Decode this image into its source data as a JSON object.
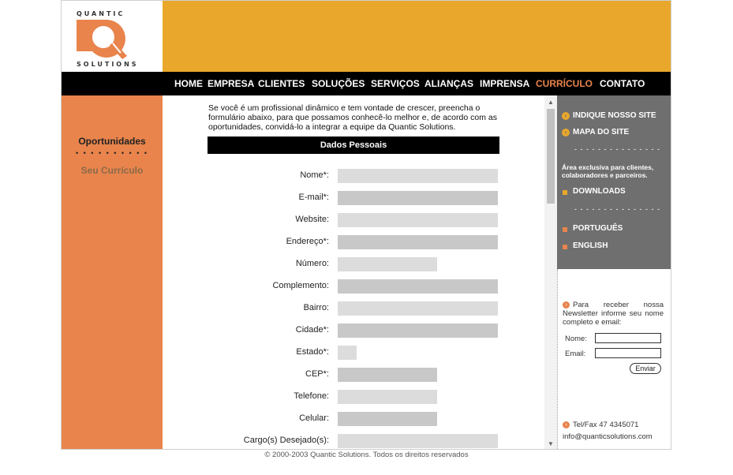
{
  "logo": {
    "top_text": "QUANTIC",
    "bottom_text": "SOLUTIONS"
  },
  "nav": [
    {
      "label": "HOME",
      "active": false
    },
    {
      "label": "EMPRESA",
      "active": false
    },
    {
      "label": "CLIENTES",
      "active": false
    },
    {
      "label": "SOLUÇÕES",
      "active": false
    },
    {
      "label": "SERVIÇOS",
      "active": false
    },
    {
      "label": "ALIANÇAS",
      "active": false
    },
    {
      "label": "IMPRENSA",
      "active": false
    },
    {
      "label": "CURRÍCULO",
      "active": true
    },
    {
      "label": "CONTATO",
      "active": false
    }
  ],
  "sidebar": {
    "opportunities": "Oportunidades",
    "dots": "• • • • • • • • • •",
    "curriculum": "Seu Currículo"
  },
  "main": {
    "intro": "Se você é um profissional dinâmico e tem vontade de crescer, preencha o formulário abaixo, para que possamos conhecê-lo melhor e, de acordo com as oportunidades, convidá-lo a integrar a equipe da Quantic Solutions.",
    "section_title": "Dados Pessoais",
    "fields": [
      {
        "label": "Nome*:",
        "value": ""
      },
      {
        "label": "E-mail*:",
        "value": ""
      },
      {
        "label": "Website:",
        "value": ""
      },
      {
        "label": "Endereço*:",
        "value": ""
      },
      {
        "label": "Número:",
        "value": ""
      },
      {
        "label": "Complemento:",
        "value": ""
      },
      {
        "label": "Bairro:",
        "value": ""
      },
      {
        "label": "Cidade*:",
        "value": ""
      },
      {
        "label": "Estado*:",
        "value": ""
      },
      {
        "label": "CEP*:",
        "value": ""
      },
      {
        "label": "Telefone:",
        "value": ""
      },
      {
        "label": "Celular:",
        "value": ""
      },
      {
        "label": "Cargo(s) Desejado(s):",
        "value": ""
      }
    ]
  },
  "right": {
    "links": [
      {
        "label": "INDIQUE NOSSO SITE",
        "icon": "arrow-circle-icon"
      },
      {
        "label": "MAPA DO SITE",
        "icon": "arrow-circle-icon"
      }
    ],
    "divider": "- - - - - - - - - - - - - - -",
    "area_text": "Área exclusiva para clientes, colaboradores e parceiros.",
    "downloads": "DOWNLOADS",
    "languages": [
      {
        "label": "PORTUGUÊS"
      },
      {
        "label": "ENGLISH"
      }
    ],
    "newsletter": {
      "text": "Para receber nossa Newsletter informe seu nome completo e email:",
      "name_label": "Nome:",
      "email_label": "Email:",
      "name_value": "",
      "email_value": "",
      "send_label": "Enviar"
    },
    "contact": {
      "phone": "Tel/Fax 47 4345071",
      "email": "info@quanticsolutions.com"
    }
  },
  "footer": "© 2000-2003 Quantic Solutions. Todos os direitos reservados",
  "colors": {
    "orange_top": "#e9a82b",
    "orange_left": "#e8844c",
    "nav_bg": "#000000",
    "nav_active": "#e9844b",
    "right_gray": "#6f6f6f"
  }
}
